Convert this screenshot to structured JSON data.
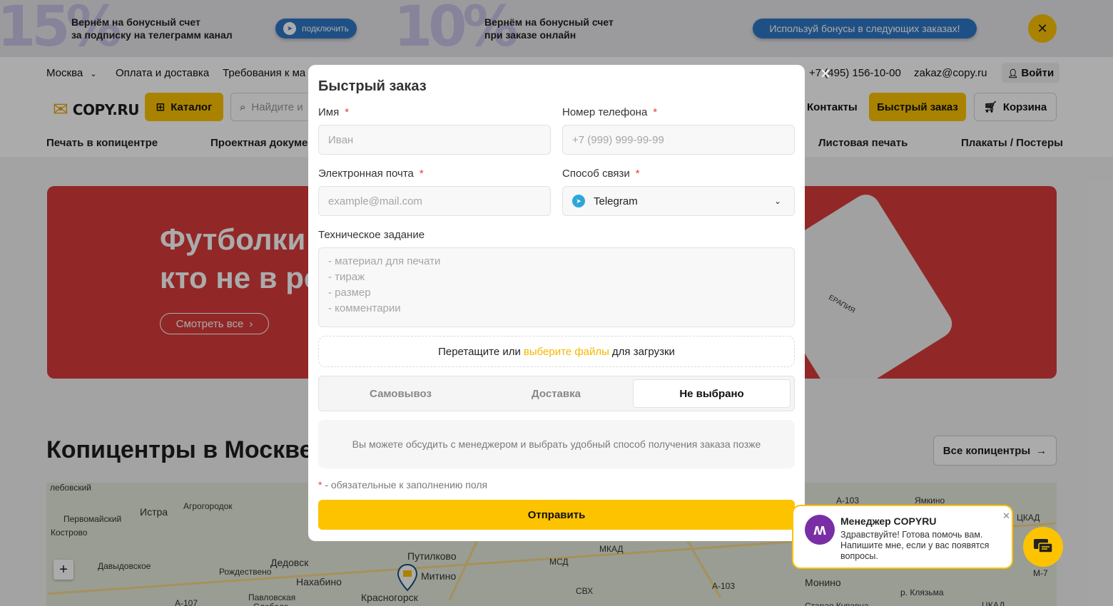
{
  "promo": {
    "left_pct": "15%",
    "left_line1": "Вернём на бонусный счет",
    "left_line2": "за подписку на телеграмм канал",
    "left_button": "подключить",
    "right_pct": "10%",
    "right_line1": "Вернём на бонусный счет",
    "right_line2": "при заказе онлайн",
    "right_button": "Используй бонусы в следующих заказах!",
    "close": "✕"
  },
  "header": {
    "city": "Москва",
    "nav1": "Оплата и доставка",
    "nav2": "Требования к ма",
    "phone": "+7 (495) 156-10-00",
    "email": "zakaz@copy.ru",
    "login": "Войти",
    "logo": "COPY.RU",
    "catalog": "Каталог",
    "search_placeholder": "Найдите и",
    "contacts": "Контакты",
    "quick_order": "Быстрый заказ",
    "cart": "Корзина",
    "cat1": "Печать в копицентре",
    "cat2": "Проектная докумен",
    "cat3": "Листовая печать",
    "cat4": "Плакаты / Постеры"
  },
  "banner": {
    "line1": "Футболки",
    "line2": "кто не в ре",
    "button": "Смотреть все",
    "tshirt_text": "ЕРАПИЯ"
  },
  "section": {
    "title": "Копицентры в Москве",
    "all_button": "Все копицентры"
  },
  "map": {
    "labels": [
      "лебовский",
      "Истра",
      "Агрогородок",
      "Первомайский",
      "Кострово",
      "Давыдовское",
      "Рождествено",
      "Дедовск",
      "Нахабино",
      "Путилково",
      "Митино",
      "Красногорск",
      "Павловская",
      "Слобода",
      "МКАД",
      "МСД",
      "СВХ",
      "A-107",
      "A-103",
      "A-103",
      "Ямкино",
      "Монино",
      "р. Клязьма",
      "M-7",
      "ЦКАД",
      "ЦКАД",
      "Старая Купавна"
    ],
    "zoom_in": "+"
  },
  "modal": {
    "title": "Быстрый заказ",
    "name_label": "Имя",
    "name_placeholder": "Иван",
    "phone_label": "Номер телефона",
    "phone_placeholder": "+7 (999) 999-99-99",
    "email_label": "Электронная почта",
    "email_placeholder": "example@mail.com",
    "contact_label": "Способ связи",
    "contact_value": "Telegram",
    "task_label": "Техническое задание",
    "task_placeholder_lines": [
      "- материал для печати",
      "- тираж",
      "- размер",
      "- комментарии"
    ],
    "upload_prefix": "Перетащите или",
    "upload_link": "выберите файлы",
    "upload_suffix": "для загрузки",
    "delivery_options": [
      "Самовывоз",
      "Доставка",
      "Не выбрано"
    ],
    "delivery_selected": "Не выбрано",
    "info_text": "Вы можете обсудить с менеджером и выбрать удобный способ получения заказа позже",
    "required_star": "*",
    "required_note": " - обязательные к заполнению поля",
    "submit": "Отправить",
    "close": "×"
  },
  "chat": {
    "name": "Менеджер COPYRU",
    "text": "Здравствуйте! Готова помочь вам. Напишите мне, если у вас появятся вопросы.",
    "close": "✕"
  },
  "colors": {
    "accent": "#fdc300",
    "banner": "#d83c3b",
    "telegram": "#2ea6da",
    "link": "#f5b800",
    "required": "#e43f3f"
  }
}
